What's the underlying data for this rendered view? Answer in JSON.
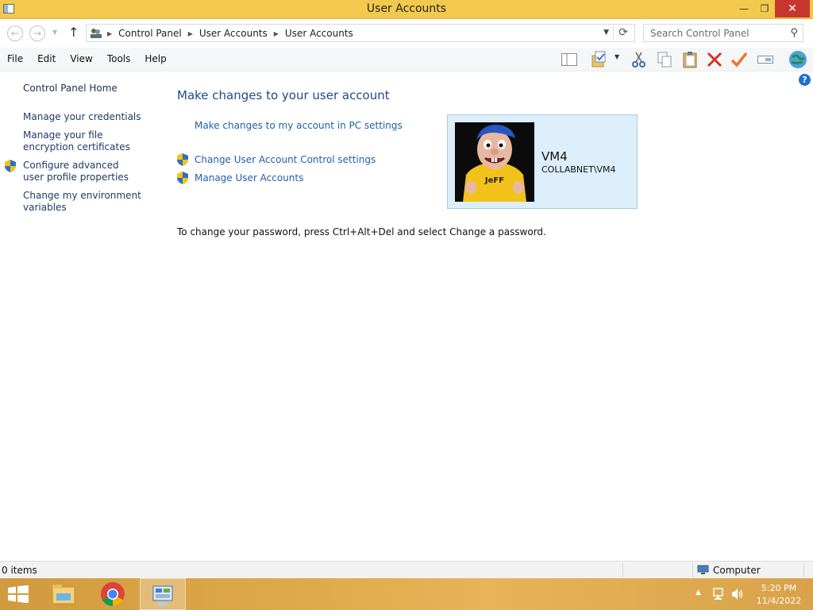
{
  "window": {
    "title": "User Accounts",
    "controls": {
      "minimize": "—",
      "maximize": "❐",
      "close": "✕"
    }
  },
  "address": {
    "breadcrumbs": [
      "Control Panel",
      "User Accounts",
      "User Accounts"
    ],
    "search_placeholder": "Search Control Panel"
  },
  "menu": [
    "File",
    "Edit",
    "View",
    "Tools",
    "Help"
  ],
  "toolbar": {
    "icons": [
      "layout-pane-icon",
      "folder-check-icon",
      "cut-icon",
      "copy-icon",
      "paste-icon",
      "delete-icon",
      "check-icon",
      "rename-icon",
      "globe-icon"
    ]
  },
  "sidebar": {
    "home": "Control Panel Home",
    "items": [
      {
        "label": "Manage your credentials",
        "shield": false
      },
      {
        "label": "Manage your file encryption certificates",
        "shield": false
      },
      {
        "label": "Configure advanced user profile properties",
        "shield": true
      },
      {
        "label": "Change my environment variables",
        "shield": false
      }
    ]
  },
  "main": {
    "heading": "Make changes to your user account",
    "pc_settings_link": "Make changes to my account in PC settings",
    "links": [
      {
        "label": "Change User Account Control settings",
        "shield": true
      },
      {
        "label": "Manage User Accounts",
        "shield": true
      }
    ],
    "password_note": "To change your password, press Ctrl+Alt+Del and select Change a password."
  },
  "user": {
    "name": "VM4",
    "domain": "COLLABNET\\VM4",
    "shirt_text": "JeFF"
  },
  "status": {
    "items": "0 items",
    "location": "Computer"
  },
  "taskbar": {
    "apps": [
      "start-button",
      "file-explorer",
      "chrome",
      "control-panel"
    ],
    "time": "5:20 PM",
    "date": "11/4/2022"
  },
  "colors": {
    "titlebar": "#f2c94c",
    "close_button": "#c7372f",
    "link": "#1f5fad",
    "heading": "#1e4b86",
    "user_card": "#dceefa"
  }
}
